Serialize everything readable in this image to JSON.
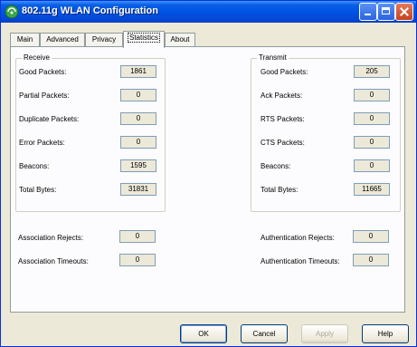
{
  "window": {
    "title": "802.11g WLAN Configuration"
  },
  "tabs": [
    {
      "label": "Main"
    },
    {
      "label": "Advanced"
    },
    {
      "label": "Privacy"
    },
    {
      "label": "Statistics"
    },
    {
      "label": "About"
    }
  ],
  "active_tab": "Statistics",
  "receive": {
    "title": "Receive",
    "rows": [
      {
        "label": "Good Packets:",
        "value": "1861"
      },
      {
        "label": "Partial Packets:",
        "value": "0"
      },
      {
        "label": "Duplicate Packets:",
        "value": "0"
      },
      {
        "label": "Error Packets:",
        "value": "0"
      },
      {
        "label": "Beacons:",
        "value": "1595"
      },
      {
        "label": "Total Bytes:",
        "value": "31831"
      }
    ]
  },
  "transmit": {
    "title": "Transmit",
    "rows": [
      {
        "label": "Good Packets:",
        "value": "205"
      },
      {
        "label": "Ack Packets:",
        "value": "0"
      },
      {
        "label": "RTS Packets:",
        "value": "0"
      },
      {
        "label": "CTS Packets:",
        "value": "0"
      },
      {
        "label": "Beacons:",
        "value": "0"
      },
      {
        "label": "Total Bytes:",
        "value": "11665"
      }
    ]
  },
  "association": {
    "rejects_label": "Association Rejects:",
    "rejects_value": "0",
    "timeouts_label": "Association Timeouts:",
    "timeouts_value": "0"
  },
  "authentication": {
    "rejects_label": "Authentication Rejects:",
    "rejects_value": "0",
    "timeouts_label": "Authentication Timeouts:",
    "timeouts_value": "0"
  },
  "buttons": {
    "ok": "OK",
    "cancel": "Cancel",
    "apply": "Apply",
    "help": "Help"
  },
  "colors": {
    "titlebar": "#0054e3",
    "face": "#ece9d8",
    "panel": "#fcfcfe"
  }
}
